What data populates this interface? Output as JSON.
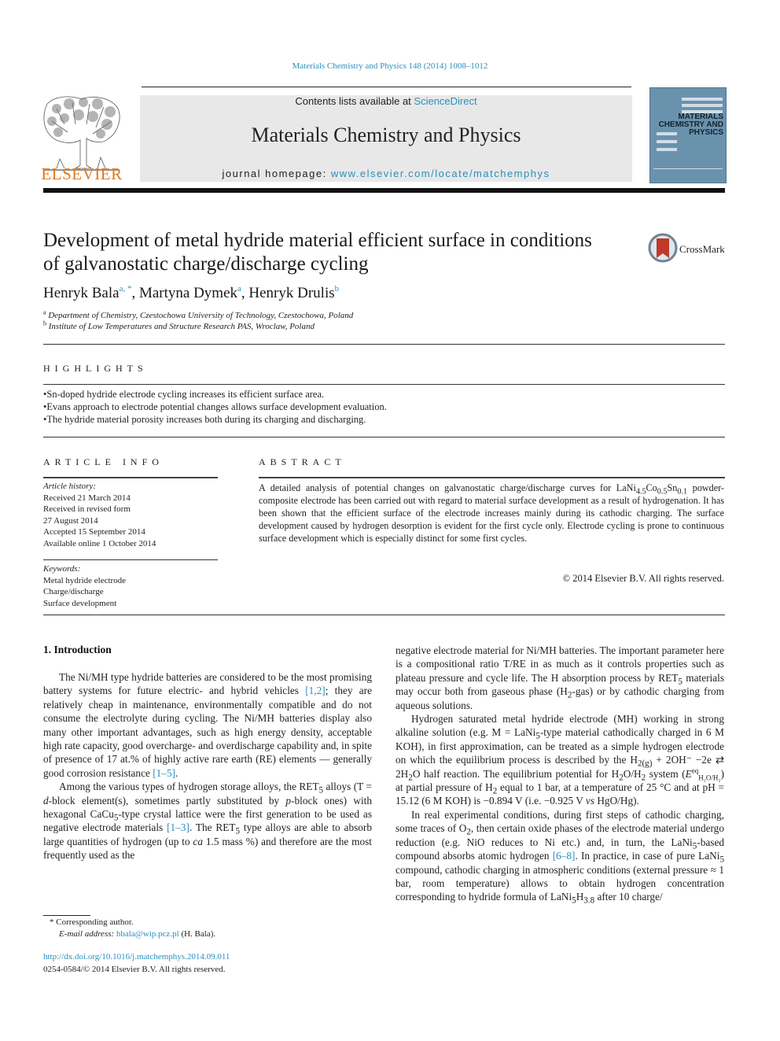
{
  "header": {
    "citation": "Materials Chemistry and Physics 148 (2014) 1008–1012",
    "contents_prefix": "Contents lists available at ",
    "contents_link": "ScienceDirect",
    "journal_title": "Materials Chemistry and Physics",
    "homepage_prefix": "journal homepage: ",
    "homepage_link": "www.elsevier.com/locate/matchemphys",
    "publisher_logo": "ELSEVIER",
    "cover": {
      "line1": "MATERIALS",
      "line2": "CHEMISTRY AND",
      "line3": "PHYSICS"
    },
    "accent_color": "#2a8fbd",
    "publisher_color": "#e2781e"
  },
  "article": {
    "title_line1": "Development of metal hydride material efficient surface in conditions",
    "title_line2": "of galvanostatic charge/discharge cycling",
    "crossmark_label": "CrossMark",
    "authors": [
      {
        "name": "Henryk Bala",
        "marks": "a, *"
      },
      {
        "name": "Martyna Dymek",
        "marks": "a"
      },
      {
        "name": "Henryk Drulis",
        "marks": "b"
      }
    ],
    "affiliations": [
      {
        "mark": "a",
        "text": "Department of Chemistry, Czestochowa University of Technology, Czestochowa, Poland"
      },
      {
        "mark": "b",
        "text": "Institute of Low Temperatures and Structure Research PAS, Wroclaw, Poland"
      }
    ]
  },
  "highlights": {
    "heading": "HIGHLIGHTS",
    "items": [
      "Sn-doped hydride electrode cycling increases its efficient surface area.",
      "Evans approach to electrode potential changes allows surface development evaluation.",
      "The hydride material porosity increases both during its charging and discharging."
    ]
  },
  "article_info": {
    "heading": "ARTICLE INFO",
    "history_label": "Article history:",
    "history": [
      "Received 21 March 2014",
      "Received in revised form",
      "27 August 2014",
      "Accepted 15 September 2014",
      "Available online 1 October 2014"
    ],
    "keywords_label": "Keywords:",
    "keywords": [
      "Metal hydride electrode",
      "Charge/discharge",
      "Surface development"
    ]
  },
  "abstract": {
    "heading": "ABSTRACT",
    "text_a": "A detailed analysis of potential changes on galvanostatic charge/discharge curves for LaNi",
    "sub1": "4.5",
    "text_b": "Co",
    "sub2": "0.5",
    "text_c": "Sn",
    "sub3": "0.1",
    "text_d": " powder-composite electrode has been carried out with regard to material surface development as a result of hydrogenation. It has been shown that the efficient surface of the electrode increases mainly during its cathodic charging. The surface development caused by hydrogen desorption is evident for the first cycle only. Electrode cycling is prone to continuous surface development which is especially distinct for some first cycles.",
    "copyright": "© 2014 Elsevier B.V. All rights reserved."
  },
  "body": {
    "section_heading": "1.  Introduction",
    "left_p1_a": "The Ni/MH type hydride batteries are considered to be the most promising battery systems for future electric- and hybrid vehicles ",
    "left_p1_ref1": "[1,2]",
    "left_p1_b": "; they are relatively cheap in maintenance, environmentally compatible and do not consume the electrolyte during cycling. The Ni/MH batteries display also many other important advantages, such as high energy density, acceptable high rate capacity, good overcharge- and overdischarge capability and, in spite of presence of 17 at.% of highly active rare earth (RE) elements — generally good corrosion resistance ",
    "left_p1_ref2": "[1–5]",
    "left_p1_c": ".",
    "left_p2_a": "Among the various types of hydrogen storage alloys, the RET",
    "left_p2_b": " alloys (T = ",
    "left_p2_d": "d",
    "left_p2_c": "-block element(s), sometimes partly substituted by ",
    "left_p2_p": "p",
    "left_p2_e": "-block ones) with hexagonal CaCu",
    "left_p2_f": "-type crystal lattice were the first generation to be used as negative electrode materials ",
    "left_p2_ref": "[1–3]",
    "left_p2_g": ". The RET",
    "left_p2_h": " type alloys are able to absorb large quantities of hydrogen (up to ",
    "left_p2_ca": "ca",
    "left_p2_i": " 1.5 mass %) and therefore are the most frequently used as the",
    "right_p1_a": "negative electrode material for Ni/MH batteries. The important parameter here is a compositional ratio T/RE in as much as it controls properties such as plateau pressure and cycle life. The H absorption process by RET",
    "right_p1_b": " materials may occur both from gaseous phase (H",
    "right_p1_c": "-gas) or by cathodic charging from aqueous solutions.",
    "right_p2_a": "Hydrogen saturated metal hydride electrode (MH) working in strong alkaline solution (e.g. M = LaNi",
    "right_p2_b": "-type material cathodically charged in 6 M KOH), in first approximation, can be treated as a simple hydrogen electrode on which the equilibrium process is described by the H",
    "right_p2_c": " + 2OH⁻ −2e ⇄ 2H",
    "right_p2_d": "O half reaction. The equilibrium potential for H",
    "right_p2_e": "O/H",
    "right_p2_f": " system (",
    "right_p2_E": "E",
    "right_p2_g": ") at partial pressure of H",
    "right_p2_h": " equal to 1 bar, at a temperature of 25 °C and at pH = 15.12 (6 M KOH) is −0.894 V (i.e. −0.925 V ",
    "right_p2_vs": "vs",
    "right_p2_i": " HgO/Hg).",
    "right_p3_a": "In real experimental conditions, during first steps of cathodic charging, some traces of O",
    "right_p3_b": ", then certain oxide phases of the electrode material undergo reduction (e.g. NiO reduces to Ni etc.) and, in turn, the LaNi",
    "right_p3_c": "-based compound absorbs atomic hydrogen ",
    "right_p3_ref": "[6–8]",
    "right_p3_d": ". In practice, in case of pure LaNi",
    "right_p3_e": " compound, cathodic charging in atmospheric conditions (external pressure ≈ 1 bar, room temperature) allows to obtain hydrogen concentration corresponding to hydride formula of LaNi",
    "right_p3_f": "H",
    "right_p3_g": " after 10 charge/",
    "sub_5": "5",
    "sub_2": "2",
    "sub_2g": "2(g)",
    "sub_38": "3.8",
    "sup_eq": "eq",
    "sub_h2o_h2": "H₂O/H₂"
  },
  "footnotes": {
    "corresponding": "* Corresponding author.",
    "email_label": "E-mail address: ",
    "email": "hbala@wip.pcz.pl",
    "email_suffix": " (H. Bala).",
    "doi": "http://dx.doi.org/10.1016/j.matchemphys.2014.09.011",
    "issn": "0254-0584/© 2014 Elsevier B.V. All rights reserved."
  }
}
